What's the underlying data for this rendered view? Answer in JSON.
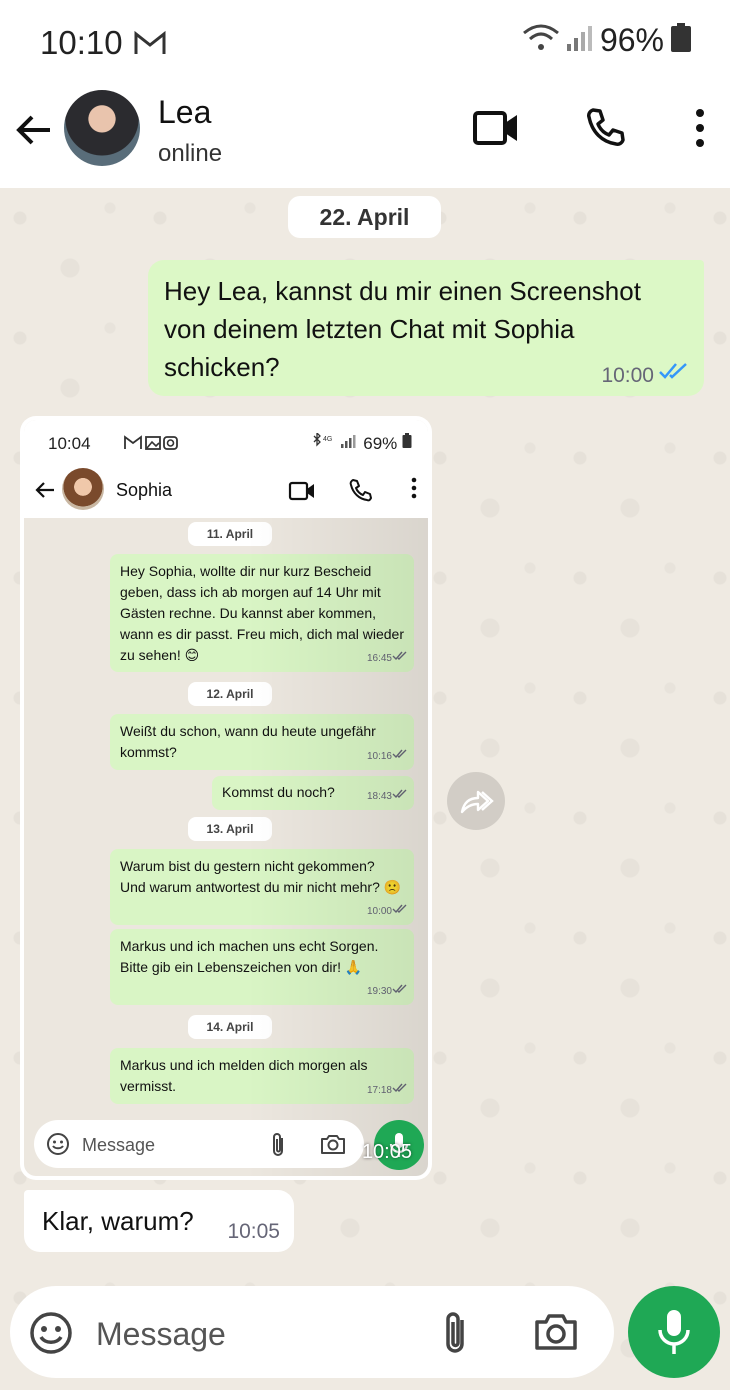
{
  "status_bar": {
    "time": "10:10",
    "battery": "96%"
  },
  "header": {
    "name": "Lea",
    "status": "online"
  },
  "chat": {
    "date": "22. April",
    "outgoing": {
      "text": "Hey Lea, kannst du mir einen Screenshot von deinem letzten Chat mit Sophia schicken?",
      "time": "10:00"
    },
    "image_message": {
      "time": "10:05",
      "screenshot": {
        "status_time": "10:04",
        "status_battery": "69%",
        "contact": "Sophia",
        "input_placeholder": "Message",
        "days": [
          {
            "date": "11. April",
            "messages": [
              {
                "text": "Hey Sophia, wollte dir nur kurz Bescheid geben, dass ich ab morgen auf 14 Uhr mit Gästen rechne. Du kannst aber kommen, wann es dir passt. Freu mich, dich mal wieder zu sehen! 😊",
                "time": "16:45"
              }
            ]
          },
          {
            "date": "12. April",
            "messages": [
              {
                "text": "Weißt du schon, wann du heute ungefähr kommst?",
                "time": "10:16"
              },
              {
                "text": "Kommst du noch?",
                "time": "18:43"
              }
            ]
          },
          {
            "date": "13. April",
            "messages": [
              {
                "text": "Warum bist du gestern nicht gekommen? Und warum antwortest du mir nicht mehr? 🙁",
                "time": "10:00"
              },
              {
                "text": "Markus und ich machen uns echt Sorgen. Bitte gib ein Lebenszeichen von dir! 🙏",
                "time": "19:30"
              }
            ]
          },
          {
            "date": "14. April",
            "messages": [
              {
                "text": "Markus und ich melden dich morgen als vermisst.",
                "time": "17:18"
              }
            ]
          }
        ]
      }
    },
    "incoming": {
      "text": "Klar, warum?",
      "time": "10:05"
    }
  },
  "input": {
    "placeholder": "Message"
  }
}
